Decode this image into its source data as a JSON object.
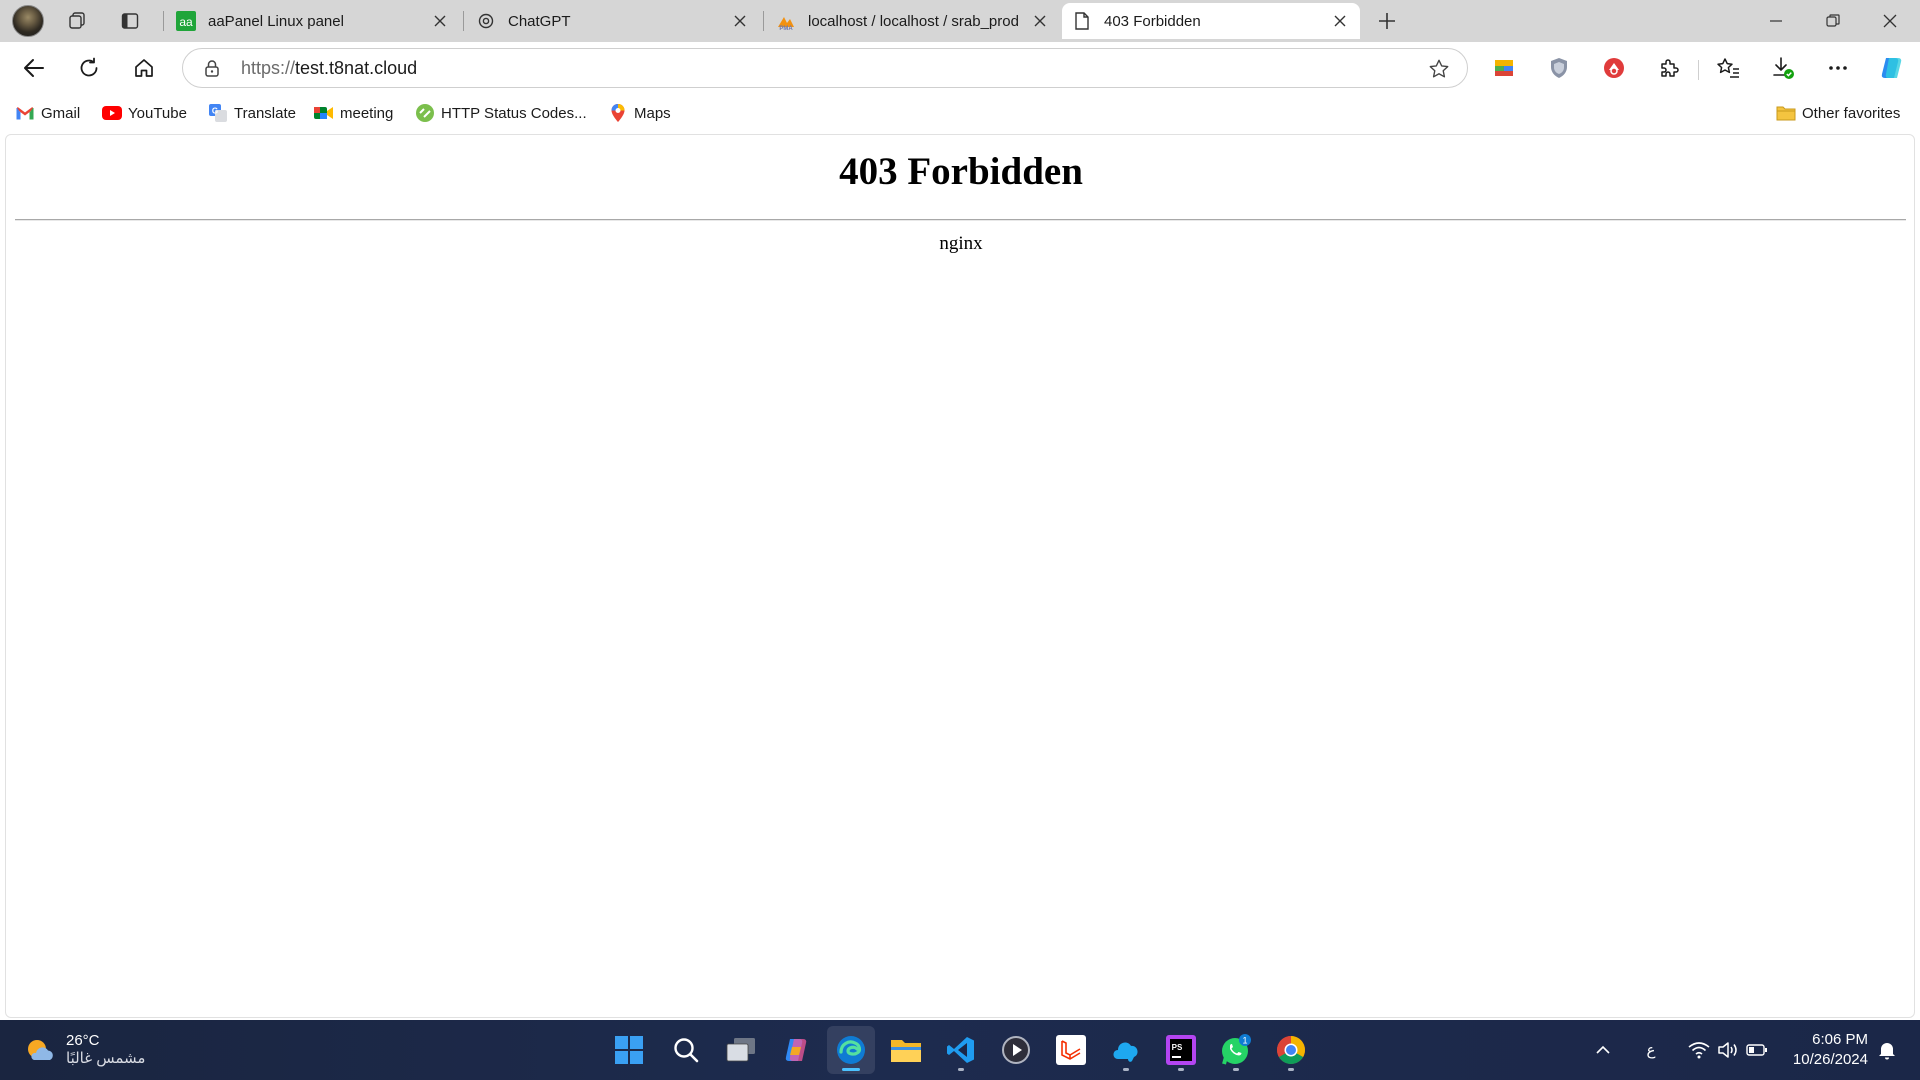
{
  "tabs": [
    {
      "title": "aaPanel Linux panel",
      "favicon": "aapanel-icon",
      "active": false
    },
    {
      "title": "ChatGPT",
      "favicon": "chatgpt-icon",
      "active": false
    },
    {
      "title": "localhost / localhost / srab_prod |",
      "favicon": "phpmyadmin-icon",
      "active": false
    },
    {
      "title": "403 Forbidden",
      "favicon": "page-icon",
      "active": true
    }
  ],
  "address_bar": {
    "scheme": "https://",
    "host": "test.t8nat.cloud"
  },
  "bookmarks": [
    {
      "label": "Gmail",
      "icon": "gmail-icon"
    },
    {
      "label": "YouTube",
      "icon": "youtube-icon"
    },
    {
      "label": "Translate",
      "icon": "translate-icon"
    },
    {
      "label": "meeting",
      "icon": "meet-icon"
    },
    {
      "label": "HTTP Status Codes...",
      "icon": "http-status-icon"
    },
    {
      "label": "Maps",
      "icon": "maps-icon"
    }
  ],
  "other_favorites": "Other favorites",
  "page": {
    "heading": "403 Forbidden",
    "server": "nginx"
  },
  "taskbar": {
    "weather_temp": "26°C",
    "weather_desc": "مشمس غالبًا",
    "language": "ع",
    "time": "6:06 PM",
    "date": "10/26/2024",
    "whatsapp_badge": "1"
  },
  "colors": {
    "accent": "#0078d4",
    "taskbar": "#1d2b4e",
    "active_indicator": "#4cc2ff"
  }
}
